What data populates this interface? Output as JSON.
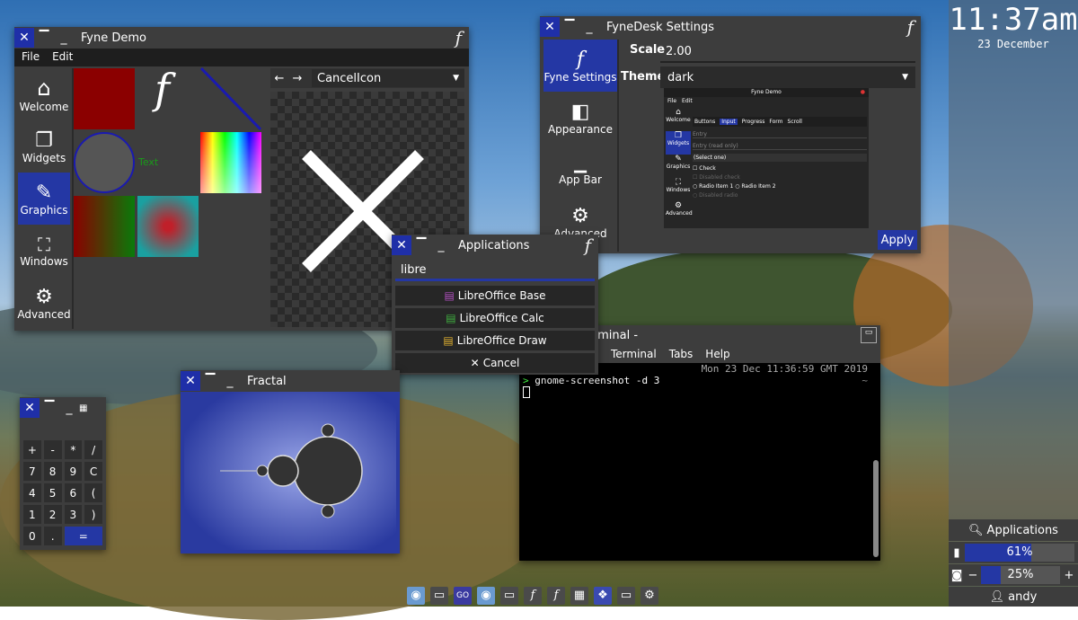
{
  "clock": {
    "time": "11:37am",
    "date": "23 December"
  },
  "demo": {
    "title": "Fyne Demo",
    "menu": [
      "File",
      "Edit"
    ],
    "nav": [
      {
        "label": "Welcome",
        "icon": "home-icon",
        "glyph": "⌂"
      },
      {
        "label": "Widgets",
        "icon": "widgets-icon",
        "glyph": "❐"
      },
      {
        "label": "Graphics",
        "icon": "pencil-icon",
        "glyph": "✎"
      },
      {
        "label": "Windows",
        "icon": "fullscreen-icon",
        "glyph": "⛶"
      },
      {
        "label": "Advanced",
        "icon": "gear-icon",
        "glyph": "⚙"
      }
    ],
    "text_label": "Text",
    "icon_select": "CancelIcon"
  },
  "settings": {
    "title": "FyneDesk Settings",
    "nav": [
      {
        "label": "Fyne Settings",
        "icon": "fyne-icon",
        "glyph": "f"
      },
      {
        "label": "Appearance",
        "icon": "appearance-icon",
        "glyph": "◧"
      },
      {
        "label": "App Bar",
        "icon": "appbar-icon",
        "glyph": "▁"
      },
      {
        "label": "Advanced",
        "icon": "gear-icon",
        "glyph": "⚙"
      }
    ],
    "scale_label": "Scale",
    "scale_value": "2.00",
    "theme_label": "Theme",
    "theme_value": "dark",
    "apply": "Apply",
    "preview": {
      "title": "Fyne Demo",
      "menu": [
        "File",
        "Edit"
      ],
      "nav": [
        "Welcome",
        "Widgets",
        "Graphics",
        "Windows",
        "Advanced"
      ],
      "tabs": [
        "Buttons",
        "Input",
        "Progress",
        "Form",
        "Scroll"
      ],
      "entry": "Entry",
      "entry_ro": "Entry (read only)",
      "select": "(Select one)",
      "check": "Check",
      "disabled_check": "Disabled check",
      "radio1": "Radio Item 1",
      "radio2": "Radio Item 2",
      "disabled_radio": "Disabled radio"
    }
  },
  "launcher": {
    "title": "Applications",
    "query": "libre",
    "apps": [
      "LibreOffice Base",
      "LibreOffice Calc",
      "LibreOffice Draw"
    ],
    "cancel": "Cancel"
  },
  "terminal": {
    "title": "Terminal -",
    "title_partial": "rminal -",
    "menu": [
      "Terminal",
      "Tabs",
      "Help"
    ],
    "timestamp": "Mon 23 Dec 11:36:59 GMT 2019",
    "prompt": ">",
    "command": "gnome-screenshot -d 3",
    "tilde": "~"
  },
  "fractal": {
    "title": "Fractal"
  },
  "calc": {
    "keys": [
      "+",
      "-",
      "*",
      "/",
      "7",
      "8",
      "9",
      "C",
      "4",
      "5",
      "6",
      "(",
      "1",
      "2",
      "3",
      ")",
      "0",
      ".",
      "="
    ]
  },
  "panel": {
    "applications": "Applications",
    "battery": "61%",
    "battery_fill": 0.61,
    "brightness": "25%",
    "brightness_fill": 0.25,
    "user": "andy",
    "minus": "−",
    "plus": "+"
  },
  "colors": {
    "accent": "#2437a4",
    "window": "#3d3d3d",
    "dark": "#1e1e1e"
  }
}
